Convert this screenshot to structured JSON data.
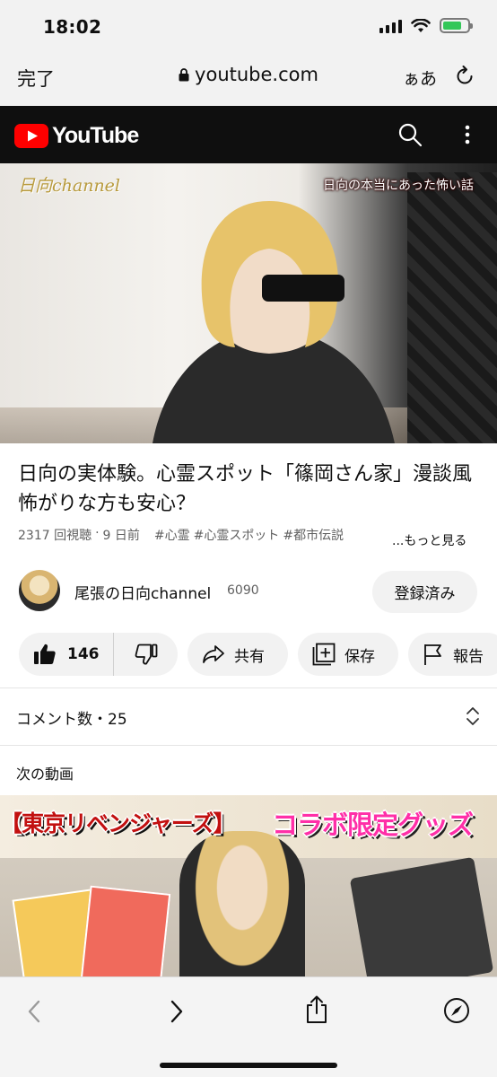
{
  "status_bar": {
    "time": "18:02"
  },
  "safari": {
    "done_label": "完了",
    "url": "youtube.com",
    "text_size_label": "ぁあ"
  },
  "youtube": {
    "logo_text": "YouTube"
  },
  "player": {
    "watermark": "日向channel",
    "subtitle": "日向の本当にあった怖い話"
  },
  "video": {
    "title": "日向の実体験。心霊スポット「篠岡さん家」漫談風 怖がりな方も安心？",
    "views": "2317 回視聴",
    "age": "9 日前",
    "hashtags": [
      "#心霊",
      "#心霊スポット",
      "#都市伝説"
    ],
    "more_label": "...もっと見る"
  },
  "channel": {
    "name": "尾張の日向channel",
    "subscribers": "6090",
    "subscribe_label": "登録済み"
  },
  "actions": {
    "like_count": "146",
    "share_label": "共有",
    "save_label": "保存",
    "report_label": "報告"
  },
  "comments": {
    "label": "コメント数・25"
  },
  "next": {
    "section_label": "次の動画",
    "thumb_left_text": "【東京リベンジャーズ】",
    "thumb_right_text": "コラボ限定グッズ"
  },
  "colors": {
    "youtube_red": "#ff0000",
    "header_bg": "#0f0f0f",
    "pill_bg": "#f2f2f2",
    "battery_green": "#34c759"
  }
}
